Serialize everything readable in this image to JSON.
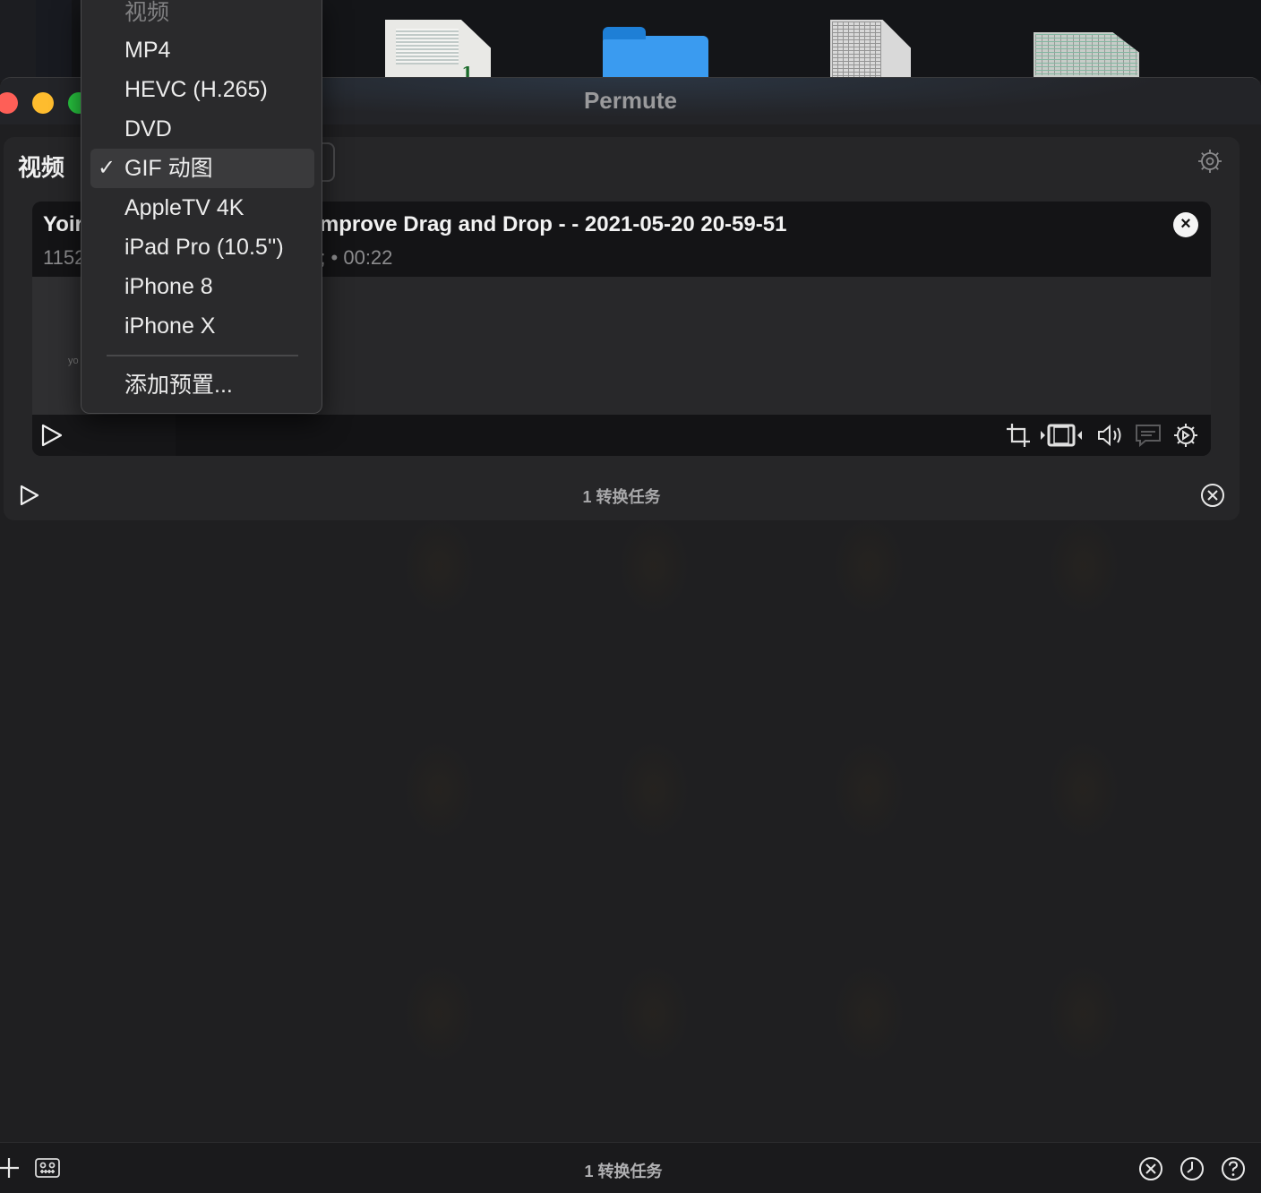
{
  "window": {
    "title": "Permute"
  },
  "group": {
    "label": "视频",
    "count_label": "1 转换任务"
  },
  "file": {
    "title_left": "Yoir",
    "title_right": "d Improve Drag and Drop -  - 2021-05-20 20-59-51",
    "meta_left": "1152",
    "meta_right": "; • 00:22",
    "thumb_text": "yo"
  },
  "menu": {
    "header": "视频",
    "items": [
      {
        "label": "MP4",
        "selected": false
      },
      {
        "label": "HEVC (H.265)",
        "selected": false
      },
      {
        "label": "DVD",
        "selected": false
      },
      {
        "label": "GIF 动图",
        "selected": true
      },
      {
        "label": "AppleTV 4K",
        "selected": false
      },
      {
        "label": "iPad Pro (10.5'')",
        "selected": false
      },
      {
        "label": "iPhone 8",
        "selected": false
      },
      {
        "label": "iPhone X",
        "selected": false
      }
    ],
    "check_mark": "✓",
    "add_preset": "添加预置..."
  },
  "bottombar": {
    "count_label": "1 转换任务"
  },
  "colors": {
    "close_red": "#fe5f57",
    "minimize_yellow": "#febc2e",
    "zoom_green": "#28c840",
    "folder_blue": "#3a9bf0"
  },
  "icons": [
    "play-icon",
    "crop-icon",
    "trim-icon",
    "volume-icon",
    "subtitles-icon",
    "gear-icon",
    "close-circle-icon",
    "plus-icon",
    "keyboard-icon",
    "history-icon",
    "help-icon"
  ]
}
